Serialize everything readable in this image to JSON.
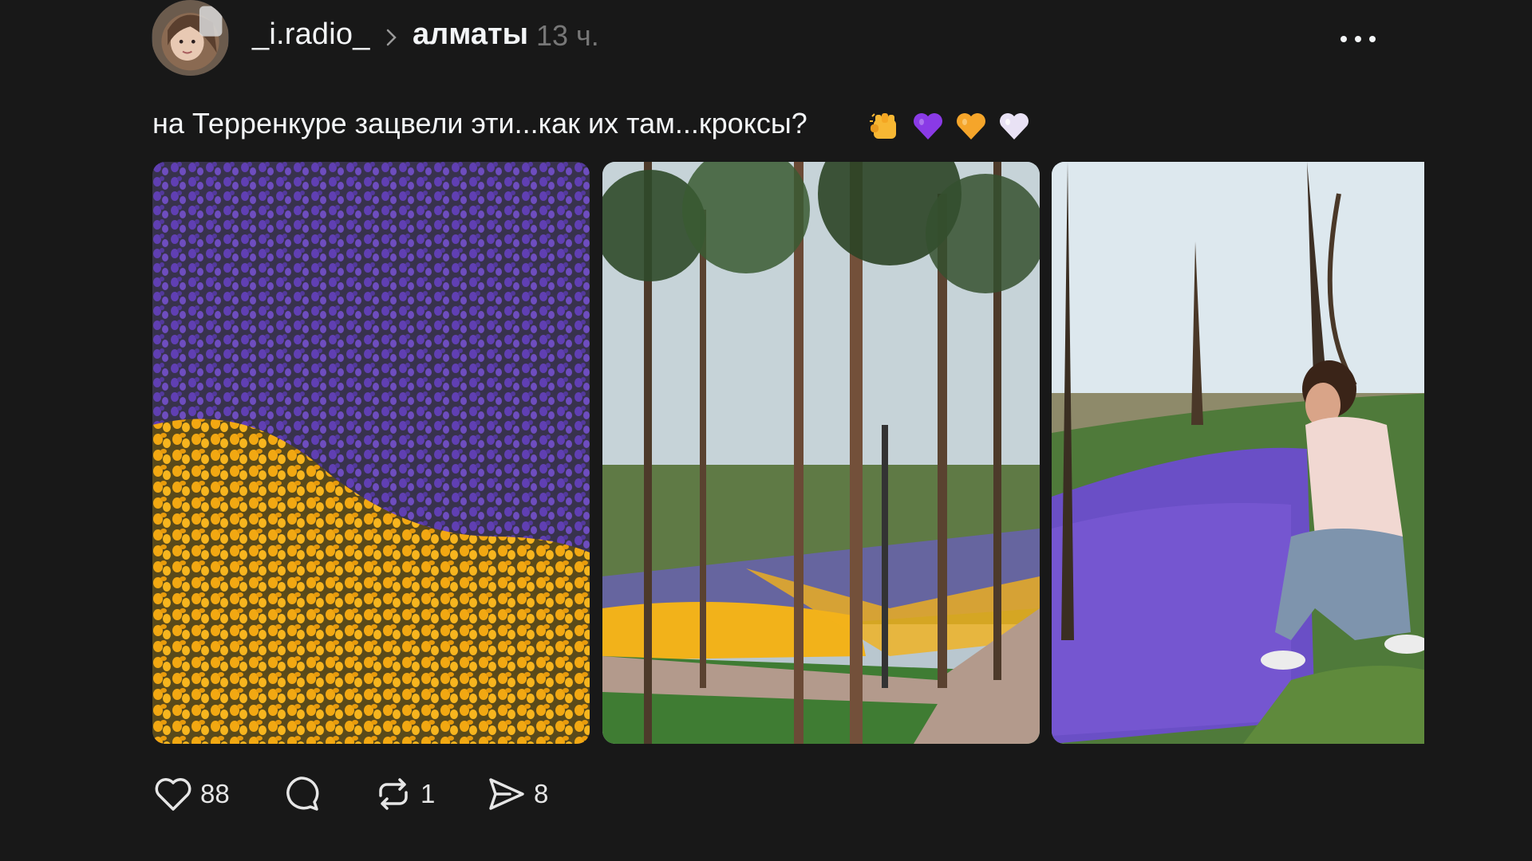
{
  "post": {
    "username": "_i.radio_",
    "location": "алматы",
    "time_ago": "13 ч.",
    "caption": "на Терренкуре зацвели эти...как их там...кроксы?",
    "caption_emojis": [
      "fist-emoji",
      "purple-heart-emoji",
      "orange-heart-emoji",
      "white-heart-emoji"
    ],
    "photos": [
      {
        "subject": "purple and yellow crocus flowerbed"
      },
      {
        "subject": "park path with trees and yellow crocuses"
      },
      {
        "subject": "woman sitting among purple crocuses"
      }
    ],
    "actions": {
      "like_icon": "heart-icon",
      "like_count": "88",
      "comment_icon": "comment-bubble-icon",
      "repost_icon": "repost-icon",
      "repost_count": "1",
      "share_icon": "send-icon",
      "share_count": "8"
    }
  },
  "colors": {
    "background": "#181818",
    "text_primary": "#f3f5f7",
    "text_secondary": "#777777"
  }
}
